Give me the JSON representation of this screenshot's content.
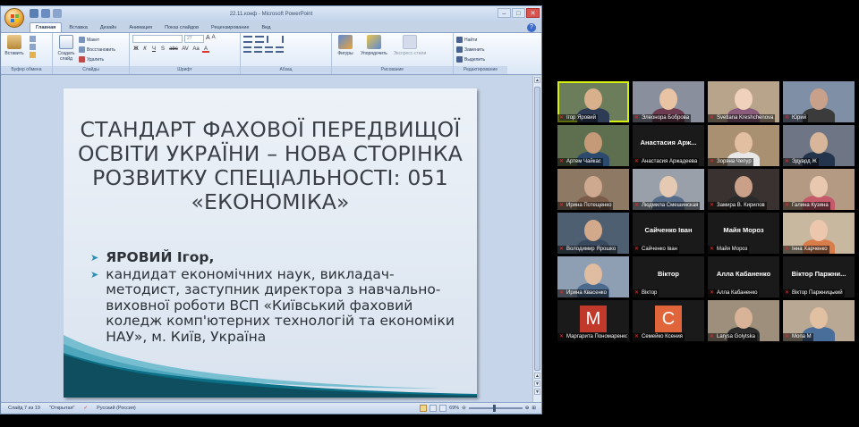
{
  "window": {
    "title": "22.11.конф - Microsoft PowerPoint",
    "controls": [
      "–",
      "□",
      "✕"
    ]
  },
  "ribbon": {
    "tabs": [
      "Главная",
      "Вставка",
      "Дизайн",
      "Анимация",
      "Показ слайдов",
      "Рецензирование",
      "Вид"
    ],
    "active_tab": "Главная",
    "clipboard": {
      "paste": "Вставить",
      "label": "Буфер обмена"
    },
    "slides": {
      "new_slide": "Создать слайд",
      "layout": "Макет",
      "reset": "Восстановить",
      "delete": "Удалить",
      "label": "Слайды"
    },
    "font": {
      "font_name": "",
      "font_size": "27",
      "label": "Шрифт",
      "buttons": [
        "Ж",
        "К",
        "Ч",
        "S",
        "abc",
        "AV",
        "Aa",
        "A"
      ]
    },
    "paragraph": {
      "label": "Абзац"
    },
    "drawing": {
      "shapes": "Фигуры",
      "arrange": "Упорядочить",
      "quick_styles": "Экспресс-стили",
      "label": "Рисование"
    },
    "editing": {
      "find": "Найти",
      "replace": "Заменить",
      "select": "Выделить",
      "label": "Редактирование"
    }
  },
  "slide": {
    "title": "СТАНДАРТ ФАХОВОЇ ПЕРЕДВИЩОЇ ОСВІТИ УКРАЇНИ – НОВА СТОРІНКА РОЗВИТКУ СПЕЦІАЛЬНОСТІ: 051 «ЕКОНОМІКА»",
    "bullets": [
      "ЯРОВИЙ Ігор,",
      "кандидат економічних наук, викладач-методист, заступник директора з навчально-виховної роботи ВСП «Київський фаховий коледж комп'ютерних технологій та економіки НАУ», м. Київ, Україна"
    ]
  },
  "statusbar": {
    "slide_info": "Слайд 7 из 19",
    "theme": "\"Открытая\"",
    "language": "Русский (Россия)",
    "zoom": "69%"
  },
  "participants": [
    {
      "name": "Ігор Яровий",
      "type": "video",
      "active": true
    },
    {
      "name": "Элеонора Боброва",
      "type": "video"
    },
    {
      "name": "Svetlana Kreshchenova",
      "type": "video"
    },
    {
      "name": "Юрий",
      "type": "video"
    },
    {
      "name": "Артем Чайкас",
      "type": "video"
    },
    {
      "name": "Анастасия Аржадеева",
      "type": "name",
      "display": "Анастасия Арж..."
    },
    {
      "name": "Зоряна Чепур",
      "type": "video"
    },
    {
      "name": "Эдуард Ж",
      "type": "video"
    },
    {
      "name": "Ирина Потещенко",
      "type": "video"
    },
    {
      "name": "Людмила Смешинская",
      "type": "video"
    },
    {
      "name": "Замира В. Кирилов",
      "type": "video"
    },
    {
      "name": "Галина Кузина",
      "type": "video"
    },
    {
      "name": "Володимир Ярошко",
      "type": "video"
    },
    {
      "name": "Сайченко Іван",
      "type": "name",
      "display": "Сайченко Іван"
    },
    {
      "name": "Майя Мороз",
      "type": "name",
      "display": "Майя Мороз"
    },
    {
      "name": "Інна Харченко",
      "type": "video"
    },
    {
      "name": "Ирина Квасенко",
      "type": "video"
    },
    {
      "name": "Віктор",
      "type": "name",
      "display": "Віктор"
    },
    {
      "name": "Алла Кабаненко",
      "type": "name",
      "display": "Алла Кабаненко"
    },
    {
      "name": "Віктор Паржницький",
      "type": "name",
      "display": "Віктор Паржни..."
    },
    {
      "name": "Маргарита Пономаренко",
      "type": "letter",
      "letter": "М",
      "color": "#c0392b"
    },
    {
      "name": "Семейко Ксения",
      "type": "letter",
      "letter": "С",
      "color": "#e0653a"
    },
    {
      "name": "Larysa Golytska",
      "type": "video"
    },
    {
      "name": "Mona M",
      "type": "video"
    }
  ]
}
